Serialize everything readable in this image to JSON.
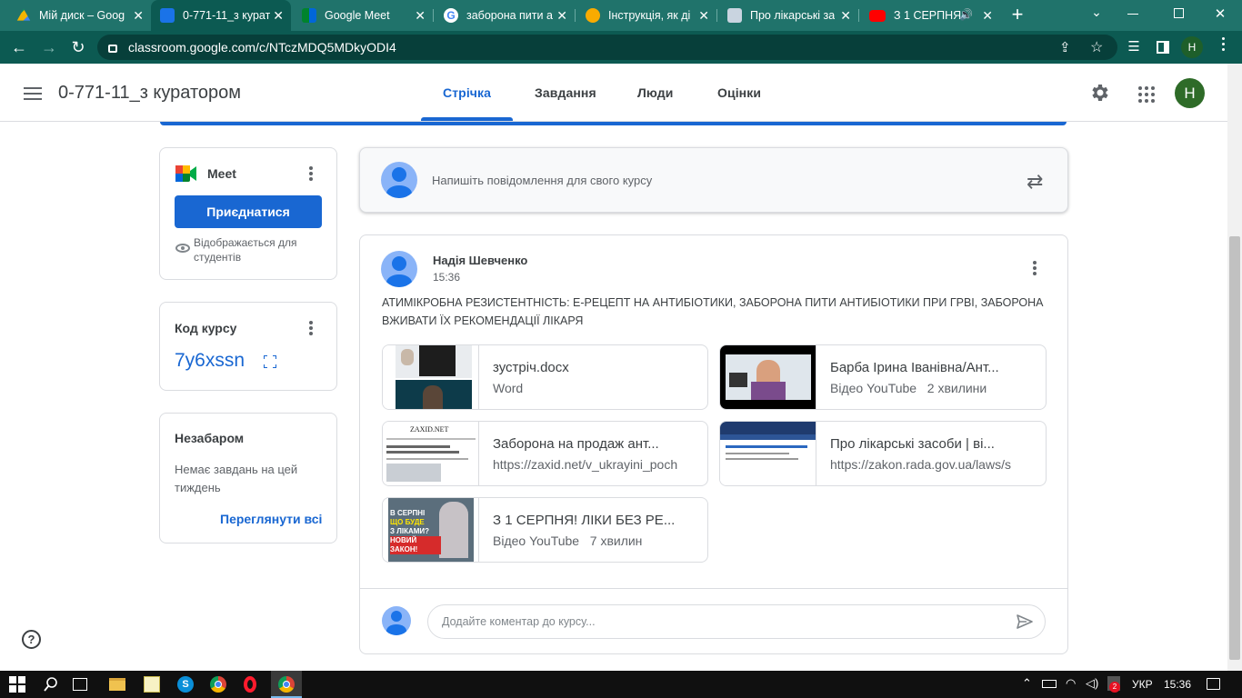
{
  "browser": {
    "tabs": [
      {
        "title": "Мій диск – Goog",
        "active": false
      },
      {
        "title": "0-771-11_з курат",
        "active": true
      },
      {
        "title": "Google Meet",
        "active": false
      },
      {
        "title": "заборона пити а",
        "active": false
      },
      {
        "title": "Інструкція, як ді",
        "active": false
      },
      {
        "title": "Про лікарські за",
        "active": false
      },
      {
        "title": "З 1 СЕРПНЯ!",
        "active": false
      }
    ],
    "url": "classroom.google.com/c/NTczMDQ5MDkyODI4",
    "profile_initial": "H",
    "theme_color": "#0c5a52"
  },
  "header": {
    "course_title": "0-771-11_з куратором",
    "tabs": [
      "Стрічка",
      "Завдання",
      "Люди",
      "Оцінки"
    ],
    "active_tab": "Стрічка",
    "avatar_initial": "Н",
    "accent": "#1967d2"
  },
  "sidebar": {
    "meet": {
      "title": "Meet",
      "join_label": "Приєднатися",
      "visibility_note": "Відображається для студентів"
    },
    "course_code": {
      "title": "Код курсу",
      "code": "7y6xssn"
    },
    "upcoming": {
      "title": "Незабаром",
      "empty_text": "Немає завдань на цей тиждень",
      "view_all": "Переглянути всі"
    }
  },
  "composer": {
    "placeholder": "Напишіть повідомлення для свого курсу"
  },
  "post": {
    "author": "Надія Шевченко",
    "time": "15:36",
    "text": "АТИМІКРОБНА РЕЗИСТЕНТНІСТЬ: Е-РЕЦЕПТ НА АНТИБІОТИКИ, ЗАБОРОНА ПИТИ АНТИБІОТИКИ ПРИ ГРВІ, ЗАБОРОНА ВЖИВАТИ ЇХ РЕКОМЕНДАЦІЇ ЛІКАРЯ",
    "attachments": [
      {
        "title": "зустріч.docx",
        "subtitle": "Word"
      },
      {
        "title": "Барба Ірина Іванівна/Ант...",
        "subtitle": "Відео YouTube   2 хвилини"
      },
      {
        "title": "Заборона на продаж ант...",
        "subtitle": "https://zaxid.net/v_ukrayini_poch"
      },
      {
        "title": "Про лікарські засоби | ві...",
        "subtitle": "https://zakon.rada.gov.ua/laws/s"
      },
      {
        "title": "З 1 СЕРПНЯ! ЛІКИ БЕЗ РЕ...",
        "subtitle": "Відео YouTube   7 хвилин"
      }
    ],
    "thumb_texts": {
      "zaxid_logo": "ZAXID.NET",
      "video_overlay": [
        "В СЕРПНІ",
        "ЩО БУДЕ",
        "З ЛІКАМИ?",
        "НОВИЙ ЗАКОН!"
      ]
    },
    "comment_placeholder": "Додайте коментар до курсу..."
  },
  "taskbar": {
    "lang": "УКР",
    "time": "15:36",
    "badge": "2"
  }
}
